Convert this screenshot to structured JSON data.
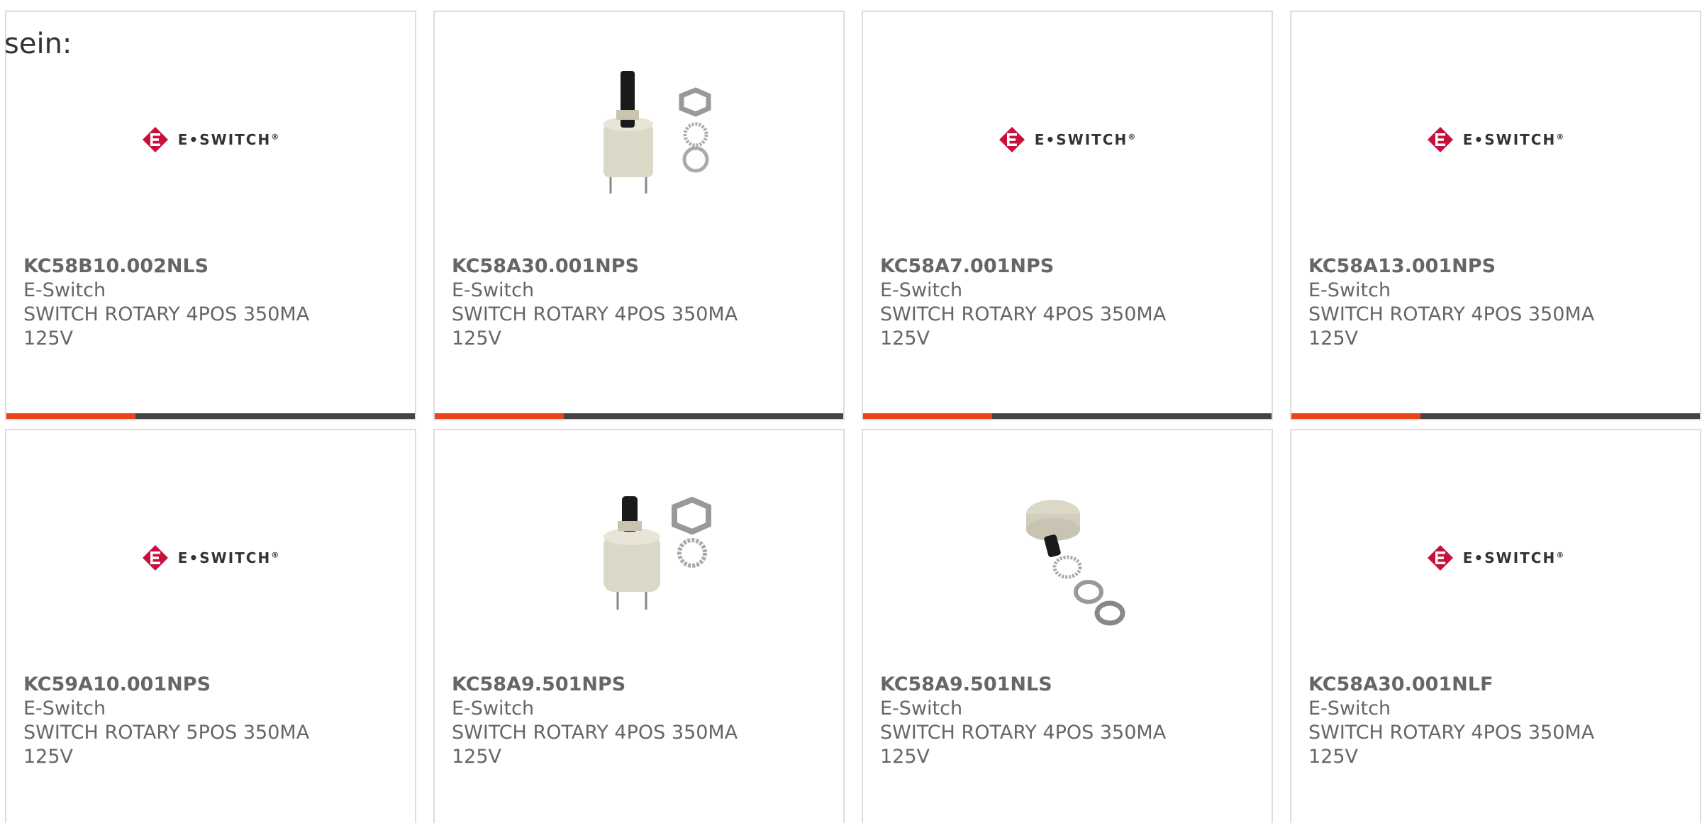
{
  "intro_text": "sein:",
  "colors": {
    "accent": "#e8451c",
    "bar_dark": "#444444",
    "border": "#dddddd",
    "text": "#666666",
    "logo_red": "#c8103e"
  },
  "products": [
    {
      "part_number": "KC58B10.002NLS",
      "manufacturer": "E-Switch",
      "description": "SWITCH ROTARY 4POS 350MA 125V",
      "image": "eswitch-logo",
      "logo_text": "E•SWITCH",
      "logo_mark": "®"
    },
    {
      "part_number": "KC58A30.001NPS",
      "manufacturer": "E-Switch",
      "description": "SWITCH ROTARY 4POS 350MA 125V",
      "image": "rotary-switch-tall-shaft"
    },
    {
      "part_number": "KC58A7.001NPS",
      "manufacturer": "E-Switch",
      "description": "SWITCH ROTARY 4POS 350MA 125V",
      "image": "eswitch-logo",
      "logo_text": "E•SWITCH",
      "logo_mark": "®"
    },
    {
      "part_number": "KC58A13.001NPS",
      "manufacturer": "E-Switch",
      "description": "SWITCH ROTARY 4POS 350MA 125V",
      "image": "eswitch-logo",
      "logo_text": "E•SWITCH",
      "logo_mark": "®"
    },
    {
      "part_number": "KC59A10.001NPS",
      "manufacturer": "E-Switch",
      "description": "SWITCH ROTARY 5POS 350MA 125V",
      "image": "eswitch-logo",
      "logo_text": "E•SWITCH",
      "logo_mark": "®"
    },
    {
      "part_number": "KC58A9.501NPS",
      "manufacturer": "E-Switch",
      "description": "SWITCH ROTARY 4POS 350MA 125V",
      "image": "rotary-switch-short-shaft"
    },
    {
      "part_number": "KC58A9.501NLS",
      "manufacturer": "E-Switch",
      "description": "SWITCH ROTARY 4POS 350MA 125V",
      "image": "rotary-switch-angled"
    },
    {
      "part_number": "KC58A30.001NLF",
      "manufacturer": "E-Switch",
      "description": "SWITCH ROTARY 4POS 350MA 125V",
      "image": "eswitch-logo",
      "logo_text": "E•SWITCH",
      "logo_mark": "®"
    }
  ]
}
